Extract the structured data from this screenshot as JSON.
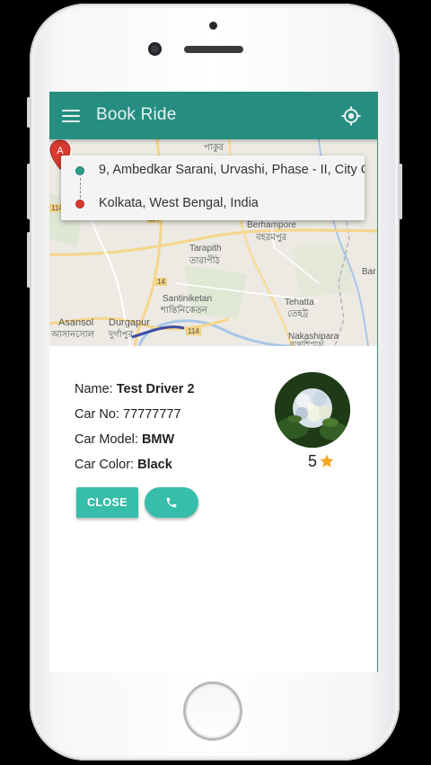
{
  "appbar": {
    "title": "Book Ride",
    "menu_icon": "menu-icon",
    "locate_icon": "my-location-icon",
    "color": "#268e81"
  },
  "route": {
    "origin": "9, Ambedkar Sarani, Urvashi, Phase - II, City C",
    "destination": "Kolkata, West Bengal, India",
    "origin_color": "#2a9a89",
    "destination_color": "#d83a30"
  },
  "map": {
    "labels": [
      "পাকুর",
      "Berhampore",
      "বহরমপুর",
      "Tarapith",
      "তারাপীঠ",
      "Santiniketan",
      "শান্তিনিকেতন",
      "Tehatta",
      "তেহট্ট",
      "Asansol",
      "আসানসোল",
      "Durgapur",
      "দুর্গাপুর",
      "Nakashipara",
      "নাকাশিপাড়া",
      "Bar",
      "14",
      "114",
      "114",
      "114"
    ],
    "pin_label": "A",
    "pin_color": "#d83a30"
  },
  "driver": {
    "name_label": "Name:",
    "name": "Test Driver 2",
    "car_no_label": "Car No:",
    "car_no": "77777777",
    "car_model_label": "Car Model:",
    "car_model": "BMW",
    "car_color_label": "Car Color:",
    "car_color": "Black",
    "rating": "5",
    "rating_icon": "star-icon",
    "star_color": "#f5a623"
  },
  "actions": {
    "close_label": "CLOSE",
    "call_icon": "phone-icon",
    "button_color": "#36beaa"
  }
}
